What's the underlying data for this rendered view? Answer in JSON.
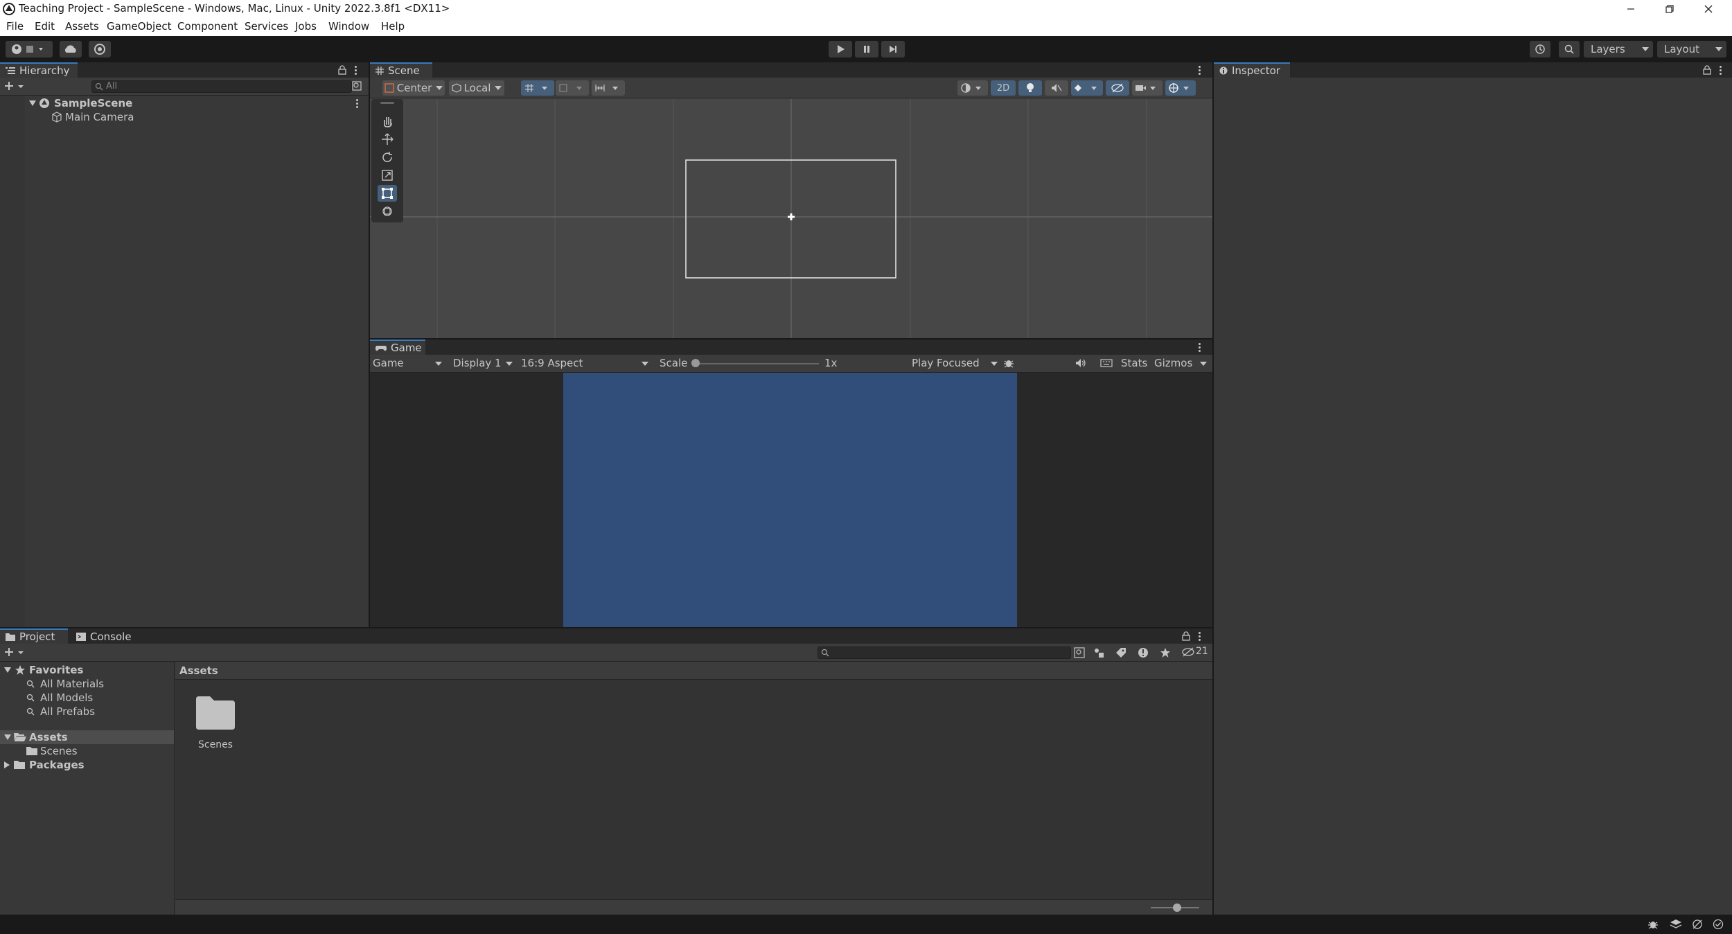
{
  "window": {
    "title": "Teaching Project - SampleScene - Windows, Mac, Linux - Unity 2022.3.8f1 <DX11>"
  },
  "menu": [
    "File",
    "Edit",
    "Assets",
    "GameObject",
    "Component",
    "Services",
    "Jobs",
    "Window",
    "Help"
  ],
  "toolbar": {
    "layers_label": "Layers",
    "layout_label": "Layout"
  },
  "hierarchy": {
    "tab_label": "Hierarchy",
    "search_placeholder": "All",
    "scene_name": "SampleScene",
    "items": [
      "Main Camera"
    ]
  },
  "scene": {
    "tab_label": "Scene",
    "pivot_label": "Center",
    "space_label": "Local",
    "mode_2d_label": "2D"
  },
  "game": {
    "tab_label": "Game",
    "view_label": "Game",
    "display_label": "Display 1",
    "aspect_label": "16:9 Aspect",
    "scale_label": "Scale",
    "scale_value": "1x",
    "play_mode_label": "Play Focused",
    "stats_label": "Stats",
    "gizmos_label": "Gizmos",
    "screen_color": "#314d79"
  },
  "inspector": {
    "tab_label": "Inspector"
  },
  "project": {
    "tab_label": "Project",
    "console_tab_label": "Console",
    "hidden_count": "21",
    "favorites_label": "Favorites",
    "favorites": [
      "All Materials",
      "All Models",
      "All Prefabs"
    ],
    "assets_label": "Assets",
    "assets_children": [
      "Scenes"
    ],
    "packages_label": "Packages",
    "breadcrumb": "Assets",
    "grid_items": [
      "Scenes"
    ]
  },
  "colors": {
    "accent": "#3a79bb",
    "panel_bg": "#383838",
    "toolbar_bg": "#191919"
  }
}
